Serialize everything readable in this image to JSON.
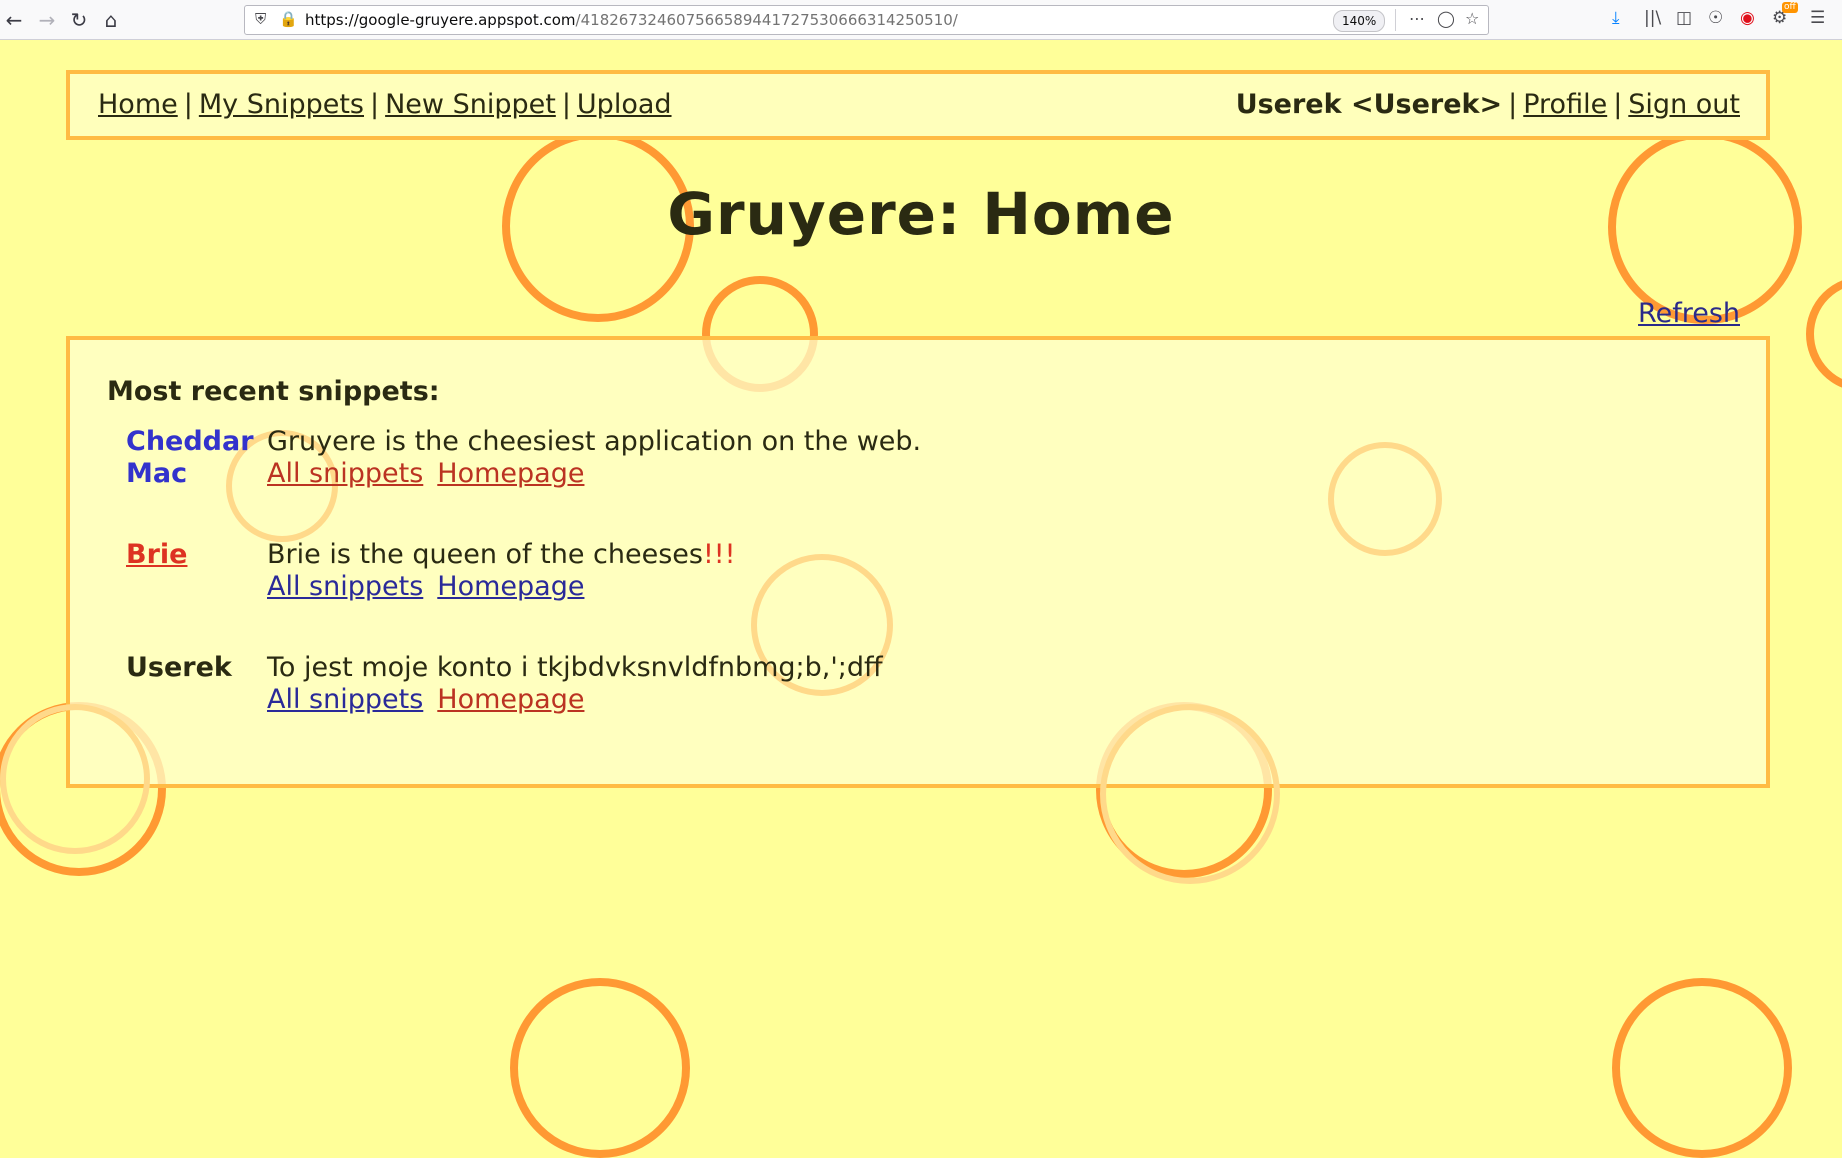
{
  "browser": {
    "url_host": "https://google-gruyere.appspot.com",
    "url_path": "/418267324607566589441727530666314250510/",
    "zoom": "140%",
    "addon_badge": "off"
  },
  "menubar": {
    "home": "Home",
    "my_snippets": "My Snippets",
    "new_snippet": "New Snippet",
    "upload": "Upload",
    "separator": "|",
    "user": "Userek <Userek>",
    "profile": "Profile",
    "sign_out": "Sign out"
  },
  "page": {
    "title": "Gruyere: Home",
    "refresh": "Refresh",
    "section_heading": "Most recent snippets:"
  },
  "snippets": [
    {
      "author": "Cheddar Mac",
      "text": "Gruyere is the cheesiest application on the web.",
      "emphasis": "",
      "all_snippets": "All snippets",
      "homepage": "Homepage"
    },
    {
      "author": "Brie",
      "text": "Brie is the queen of the cheeses",
      "emphasis": "!!!",
      "all_snippets": "All snippets",
      "homepage": "Homepage"
    },
    {
      "author": "Userek",
      "text": "To jest moje konto i tkjbdvksnvldfnbmg;b,';dff",
      "emphasis": "",
      "all_snippets": "All snippets",
      "homepage": "Homepage"
    }
  ],
  "colors": {
    "background": "#ffff99",
    "panel": "#ffffbb",
    "panel_border": "#ffbb44",
    "bubble": "#ff9933",
    "link_blue": "#3333cc",
    "link_red": "#dd3322"
  }
}
